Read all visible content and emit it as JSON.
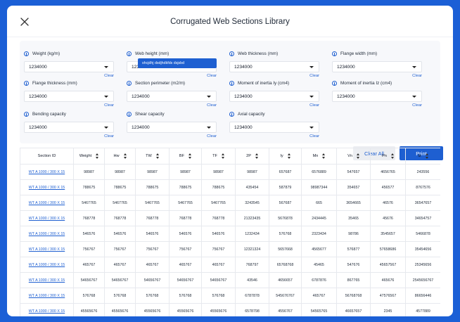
{
  "title": "Corrugated Web Sections Library",
  "filters": [
    {
      "label": "Weight (kg/m)",
      "value": "1234000",
      "clear": "Clear"
    },
    {
      "label": "Web height (mm)",
      "value": "1234000",
      "clear": "Clear"
    },
    {
      "label": "Web thickness (mm)",
      "value": "1234000",
      "clear": "Clear"
    },
    {
      "label": "Flange width (mm)",
      "value": "1234000",
      "clear": "Clear"
    },
    {
      "label": "Flange thickness (mm)",
      "value": "1234000",
      "clear": "Clear"
    },
    {
      "label": "Section perimeter (m2/m)",
      "value": "1234000",
      "clear": "Clear"
    },
    {
      "label": "Moment of inertia Iy (cm4)",
      "value": "1234000",
      "clear": "Clear"
    },
    {
      "label": "Moment of inertia Iz (cm4)",
      "value": "1234000",
      "clear": "Clear"
    },
    {
      "label": "Bending capacity",
      "value": "1234000",
      "clear": "Clear"
    },
    {
      "label": "Shear capacity",
      "value": "1234000",
      "clear": "Clear"
    },
    {
      "label": "Axial capacity",
      "value": "1234000",
      "clear": "Clear"
    }
  ],
  "tooltip": "shcjdhj dsdjhdkfds dsjsbd",
  "buttons": {
    "clear_all": "Clear All",
    "print": "Print"
  },
  "table": {
    "columns": [
      "Section ID",
      "Weight",
      "Hw",
      "TW",
      "BF",
      "TF",
      "2P",
      "Iy",
      "Mn",
      "Vn",
      "Pn",
      "Iz"
    ],
    "rows": [
      [
        "WT A 1000 / 300 X 15",
        "98987",
        "98987",
        "98987",
        "98987",
        "98987",
        "98987",
        "657687",
        "6576889",
        "547657",
        "4656765",
        "243556"
      ],
      [
        "WT A 1000 / 300 X 15",
        "788675",
        "788675",
        "788675",
        "788675",
        "788675",
        "435454",
        "587879",
        "98987344",
        "354657",
        "456577",
        "8767576"
      ],
      [
        "WT A 1000 / 300 X 15",
        "5467765",
        "5467765",
        "5467765",
        "5467765",
        "5467765",
        "3243545",
        "567687",
        "665",
        "3654665",
        "46576",
        "36547657"
      ],
      [
        "WT A 1000 / 300 X 15",
        "768778",
        "768778",
        "768778",
        "768778",
        "768778",
        "21323435",
        "5676878",
        "2434445",
        "35465",
        "45676",
        "34654757"
      ],
      [
        "WT A 1000 / 300 X 15",
        "546576",
        "546576",
        "546576",
        "546576",
        "546576",
        "1232434",
        "576768",
        "2323434",
        "98786",
        "3545657",
        "5466878"
      ],
      [
        "WT A 1000 / 300 X 15",
        "756767",
        "756767",
        "756767",
        "756767",
        "756767",
        "12321324",
        "5657668",
        "4565677",
        "576877",
        "57658686",
        "35454656"
      ],
      [
        "WT A 1000 / 300 X 15",
        "465767",
        "465767",
        "465767",
        "465767",
        "465767",
        "768797",
        "65768768",
        "45465",
        "547676",
        "45657567",
        "25345656"
      ],
      [
        "WT A 1000 / 300 X 15",
        "54656767",
        "54656767",
        "54656767",
        "54656767",
        "54656767",
        "43546",
        "4656657",
        "6787876",
        "867765",
        "465676",
        "2545656767"
      ],
      [
        "WT A 1000 / 300 X 15",
        "576768",
        "576768",
        "576768",
        "576768",
        "576768",
        "6787878",
        "545676767",
        "465767",
        "56768768",
        "47576567",
        "86656446"
      ],
      [
        "WT A 1000 / 300 X 15",
        "45565676",
        "45565676",
        "45565676",
        "45565676",
        "45565676",
        "6578798",
        "4556767",
        "54565765",
        "46657657",
        "2345",
        "4577889"
      ]
    ]
  }
}
